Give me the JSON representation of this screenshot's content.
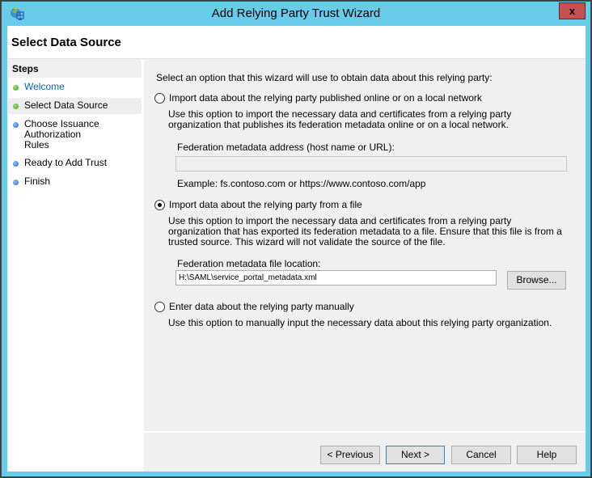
{
  "window": {
    "title": "Add Relying Party Trust Wizard",
    "close_label": "x",
    "icon": "adfs-relying-party-icon"
  },
  "header": {
    "page_title": "Select Data Source"
  },
  "steps": {
    "title": "Steps",
    "items": [
      {
        "label": "Welcome",
        "status": "complete",
        "color": "#3aa61c",
        "link": true
      },
      {
        "label": "Select Data Source",
        "status": "current",
        "color": "#3aa61c",
        "link": false
      },
      {
        "label": "Choose Issuance Authorization Rules",
        "status": "pending",
        "color": "#2168d8",
        "link": false
      },
      {
        "label": "Ready to Add Trust",
        "status": "pending",
        "color": "#2168d8",
        "link": false
      },
      {
        "label": "Finish",
        "status": "pending",
        "color": "#2168d8",
        "link": false
      }
    ]
  },
  "main": {
    "intro": "Select an option that this wizard will use to obtain data about this relying party:",
    "option_online": {
      "label": "Import data about the relying party published online or on a local network",
      "checked": false,
      "description": "Use this option to import the necessary data and certificates from a relying party organization that publishes its federation metadata online or on a local network.",
      "field_label": "Federation metadata address (host name or URL):",
      "field_value": "",
      "example": "Example: fs.contoso.com or https://www.contoso.com/app"
    },
    "option_file": {
      "label": "Import data about the relying party from a file",
      "checked": true,
      "description": "Use this option to import the necessary data and certificates from a relying party organization that has exported its federation metadata to a file. Ensure that this file is from a trusted source.  This wizard will not validate the source of the file.",
      "field_label": "Federation metadata file location:",
      "field_value": "H:\\SAML\\service_portal_metadata.xml",
      "browse_label": "Browse..."
    },
    "option_manual": {
      "label": "Enter data about the relying party manually",
      "checked": false,
      "description": "Use this option to manually input the necessary data about this relying party organization."
    }
  },
  "footer": {
    "previous_label": "< Previous",
    "next_label": "Next >",
    "cancel_label": "Cancel",
    "help_label": "Help"
  }
}
